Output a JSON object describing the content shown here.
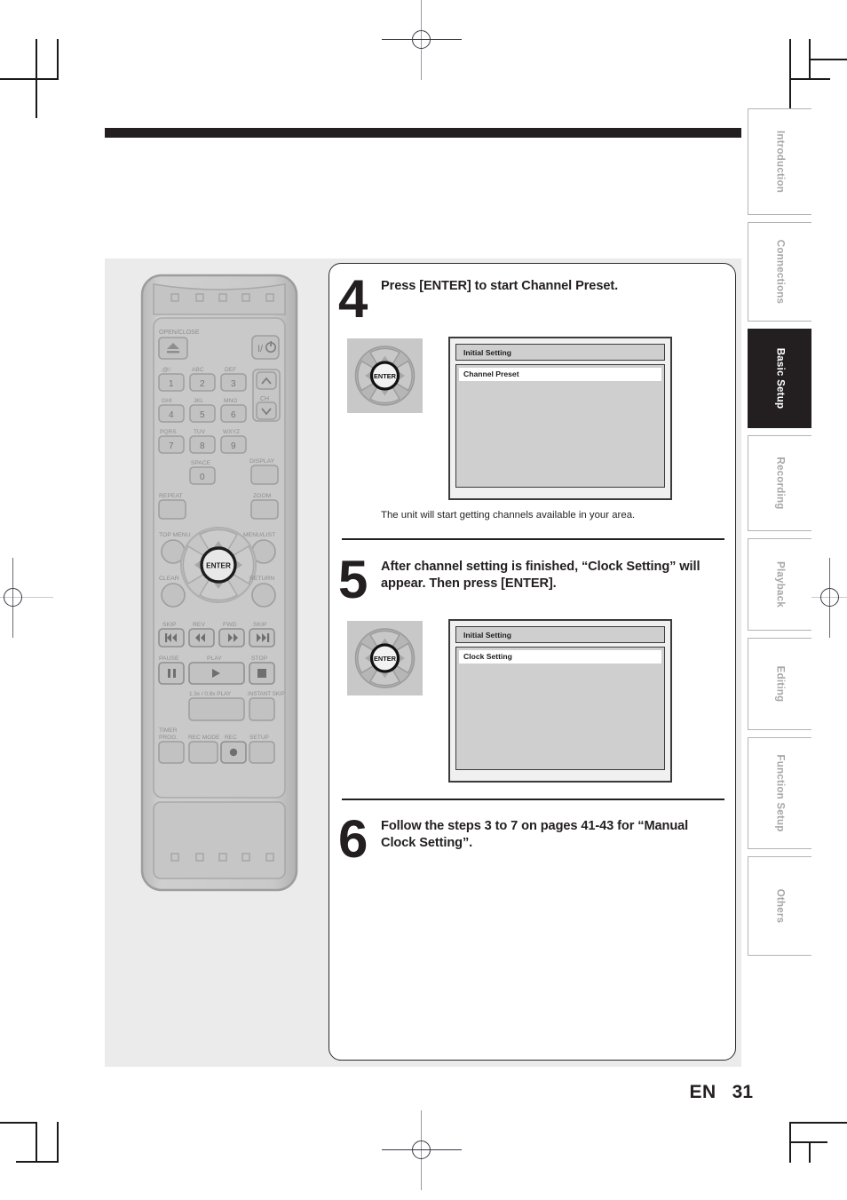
{
  "page": {
    "language_code": "EN",
    "page_number": "31"
  },
  "sidebar": {
    "tabs": [
      {
        "label": "Introduction",
        "active": false
      },
      {
        "label": "Connections",
        "active": false
      },
      {
        "label": "Basic Setup",
        "active": true
      },
      {
        "label": "Recording",
        "active": false
      },
      {
        "label": "Playback",
        "active": false
      },
      {
        "label": "Editing",
        "active": false
      },
      {
        "label": "Function Setup",
        "active": false
      },
      {
        "label": "Others",
        "active": false
      }
    ]
  },
  "steps": [
    {
      "number": "4",
      "title": "Press [ENTER] to start Channel Preset.",
      "caption": "The unit will start getting channels available in your area.",
      "remote_icon": "dpad-enter-icon",
      "osd": {
        "title": "Initial Setting",
        "selected_row": "Channel Preset"
      }
    },
    {
      "number": "5",
      "title": "After channel setting is finished, “Clock Setting” will appear. Then press [ENTER].",
      "caption": "",
      "remote_icon": "dpad-enter-icon",
      "osd": {
        "title": "Initial Setting",
        "selected_row": "Clock Setting"
      }
    },
    {
      "number": "6",
      "title": "Follow the steps 3 to 7 on pages 41-43 for “Manual Clock Setting”.",
      "caption": "",
      "remote_icon": null,
      "osd": null
    }
  ],
  "remote": {
    "name": "remote-control-illustration",
    "labels": {
      "open_close": "OPEN/CLOSE",
      "power": "I/⏻",
      "ch": "CH",
      "display": "DISPLAY",
      "zoom": "ZOOM",
      "repeat": "REPEAT",
      "top_menu": "TOP MENU",
      "menu_list": "MENU/LIST",
      "clear": "CLEAR",
      "return": "RETURN",
      "enter": "ENTER",
      "skip_back": "SKIP",
      "rev": "REV",
      "fwd": "FWD",
      "skip_fwd": "SKIP",
      "pause": "PAUSE",
      "play": "PLAY",
      "stop": "STOP",
      "speed_play": "1.3x / 0.8x PLAY",
      "instant_skip": "INSTANT SKIP",
      "timer_prog": "TIMER PROG.",
      "rec_mode": "REC MODE",
      "rec": "REC",
      "setup": "SETUP"
    },
    "keypad": [
      {
        "digit": "1",
        "letters": ".@/:"
      },
      {
        "digit": "2",
        "letters": "ABC"
      },
      {
        "digit": "3",
        "letters": "DEF"
      },
      {
        "digit": "4",
        "letters": "GHI"
      },
      {
        "digit": "5",
        "letters": "JKL"
      },
      {
        "digit": "6",
        "letters": "MNO"
      },
      {
        "digit": "7",
        "letters": "PQRS"
      },
      {
        "digit": "8",
        "letters": "TUV"
      },
      {
        "digit": "9",
        "letters": "WXYZ"
      },
      {
        "digit": "0",
        "letters": "SPACE"
      }
    ]
  },
  "colors": {
    "ink": "#231f20",
    "panel_gray": "#ebebeb",
    "osd_gray": "#cfcfcf",
    "tab_inactive_text": "#a7a7a7",
    "remote_body": "#c6c6c6"
  }
}
